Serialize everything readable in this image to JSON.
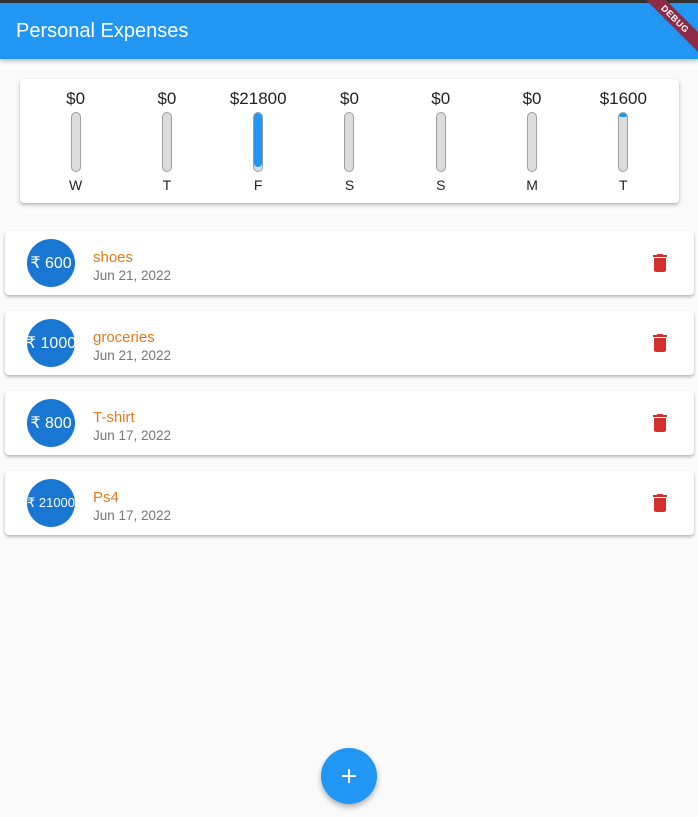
{
  "app_bar": {
    "title": "Personal Expenses",
    "color": "#2196f3"
  },
  "debug_banner": {
    "label": "DEBUG",
    "color": "#8e2a46"
  },
  "weekly_chart": {
    "bars": [
      {
        "day": "W",
        "amount": "$0",
        "fraction": 0
      },
      {
        "day": "T",
        "amount": "$0",
        "fraction": 0
      },
      {
        "day": "F",
        "amount": "$21800",
        "fraction": 0.9316
      },
      {
        "day": "S",
        "amount": "$0",
        "fraction": 0
      },
      {
        "day": "S",
        "amount": "$0",
        "fraction": 0
      },
      {
        "day": "M",
        "amount": "$0",
        "fraction": 0
      },
      {
        "day": "T",
        "amount": "$1600",
        "fraction": 0.0684
      }
    ],
    "fill_color": "#2196f3",
    "track_color": "#dcdcdc"
  },
  "transactions": [
    {
      "amount": "₹ 600",
      "title": "shoes",
      "date": "Jun 21, 2022"
    },
    {
      "amount": "₹ 1000",
      "title": "groceries",
      "date": "Jun 21, 2022"
    },
    {
      "amount": "₹ 800",
      "title": "T-shirt",
      "date": "Jun 17, 2022"
    },
    {
      "amount": "₹ 21000",
      "title": "Ps4",
      "date": "Jun 17, 2022"
    }
  ],
  "icons": {
    "delete": "trash-icon",
    "add": "plus-icon"
  },
  "colors": {
    "primary": "#2196f3",
    "avatar": "#1976d2",
    "title_text": "#e07b1a",
    "delete_icon": "#d32f2f"
  }
}
